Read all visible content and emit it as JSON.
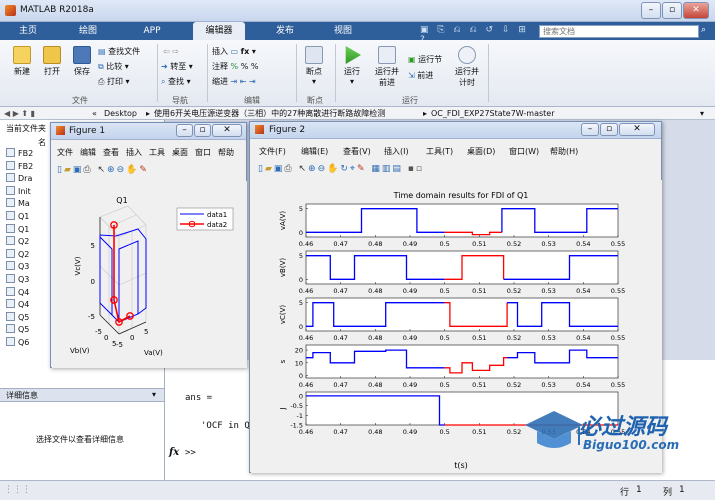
{
  "window": {
    "title": "MATLAB R2018a"
  },
  "search": {
    "placeholder": "搜索文档"
  },
  "main_tabs": [
    "主页",
    "绘图",
    "APP",
    "编辑器",
    "发布",
    "视图"
  ],
  "ribbon": {
    "new": "新建",
    "open": "打开",
    "save": "保存",
    "find_files": "查找文件",
    "compare": "比较",
    "print": "打印",
    "goto": "转至",
    "find": "查找",
    "insert": "插入",
    "comment": "注释",
    "indent": "缩进",
    "breakpoints": "断点",
    "run": "运行",
    "run_advance": "运行并\n前进",
    "run_section": "运行节",
    "advance": "前进",
    "run_time": "运行并\n计时",
    "groups": {
      "file": "文件",
      "nav": "导航",
      "edit": "编辑",
      "bp": "断点",
      "run": "运行"
    }
  },
  "address": {
    "prefix": "«",
    "parts": [
      "Desktop",
      "使用6开关电压源逆变器（三相）中的27种离散进行断路故障检测",
      "OC_FDI_EXP27State7W-master"
    ]
  },
  "left_panel": {
    "header": "当前文件夹",
    "col": "名",
    "files": [
      "FB2",
      "FB2",
      "Dra",
      "Init",
      "Ma",
      "Q1",
      "Q1",
      "Q2",
      "Q2",
      "Q3",
      "Q3",
      "Q4",
      "Q4",
      "Q5",
      "Q5",
      "Q6"
    ],
    "details_title": "详细信息",
    "details_msg": "选择文件以查看详细信息"
  },
  "command": {
    "lines": [
      "ans =",
      "'OCF in Q",
      ">>"
    ],
    "fx": "fx"
  },
  "status": {
    "row_label": "行",
    "row": "1",
    "col_label": "列",
    "col": "1"
  },
  "figure1": {
    "title": "Figure 1",
    "menu": [
      "文件",
      "编辑",
      "查看",
      "插入",
      "工具",
      "桌面",
      "窗口",
      "帮助"
    ],
    "plot_title": "Q1",
    "zlabel": "Vc(V)",
    "xlabel": "Vb(V)",
    "ylabel": "Va(V)",
    "zticks": [
      "5",
      "0",
      "-5"
    ],
    "xticks": [
      "-5",
      "0",
      "5"
    ],
    "yticks": [
      "-5",
      "0",
      "5"
    ],
    "legend": [
      "data1",
      "data2"
    ],
    "series_colors": [
      "#0000ff",
      "#ff0000"
    ]
  },
  "figure2": {
    "title": "Figure 2",
    "menu": [
      "文件(F)",
      "编辑(E)",
      "查看(V)",
      "插入(I)",
      "工具(T)",
      "桌面(D)",
      "窗口(W)",
      "帮助(H)"
    ],
    "plot_title": "Time domain results for FDI of Q1",
    "xlabel": "t(s)",
    "xticks": [
      "0.46",
      "0.47",
      "0.48",
      "0.49",
      "0.5",
      "0.51",
      "0.52",
      "0.53",
      "0.54",
      "0.55"
    ],
    "ylabels": [
      "vA(V)",
      "vB(V)",
      "vC(V)",
      "s",
      "J"
    ],
    "normal_color": "#0000ff",
    "fault_color": "#ff0000"
  },
  "chart_data": [
    {
      "type": "line",
      "title": "Time domain results for FDI of Q1",
      "xlabel": "t(s)",
      "xlim": [
        0.46,
        0.55
      ],
      "panels": [
        {
          "ylabel": "vA(V)",
          "ylim": [
            -1,
            6
          ],
          "yticks": [
            "5",
            "0"
          ],
          "series": [
            {
              "color": "#0000ff",
              "x": [
                0.46,
                0.476,
                0.476,
                0.492,
                0.492,
                0.5
              ],
              "y": [
                0,
                0,
                5,
                5,
                0,
                0
              ]
            },
            {
              "color": "#ff0000",
              "x": [
                0.5,
                0.508,
                0.508,
                0.513,
                0.513,
                0.5165
              ],
              "y": [
                0,
                0,
                -0.5,
                -0.5,
                0,
                0
              ]
            },
            {
              "color": "#0000ff",
              "x": [
                0.5165,
                0.5165,
                0.526,
                0.526,
                0.541,
                0.541,
                0.55
              ],
              "y": [
                0,
                5,
                5,
                0,
                0,
                5,
                5
              ]
            }
          ]
        },
        {
          "ylabel": "vB(V)",
          "ylim": [
            -1,
            6
          ],
          "yticks": [
            "5",
            "0"
          ],
          "series": [
            {
              "color": "#0000ff",
              "x": [
                0.46,
                0.467,
                0.467,
                0.474,
                0.474,
                0.489,
                0.489,
                0.5
              ],
              "y": [
                5,
                5,
                0,
                0,
                5,
                5,
                0,
                0
              ]
            },
            {
              "color": "#ff0000",
              "x": [
                0.5,
                0.505,
                0.505,
                0.517,
                0.517
              ],
              "y": [
                0,
                0,
                5,
                5,
                0
              ]
            },
            {
              "color": "#0000ff",
              "x": [
                0.517,
                0.536,
                0.536,
                0.55
              ],
              "y": [
                0,
                0,
                5,
                5
              ]
            }
          ]
        },
        {
          "ylabel": "vC(V)",
          "ylim": [
            -1,
            6
          ],
          "yticks": [
            "5",
            "0"
          ],
          "series": [
            {
              "color": "#0000ff",
              "x": [
                0.46,
                0.462,
                0.462,
                0.468,
                0.468,
                0.483,
                0.483,
                0.5
              ],
              "y": [
                0,
                0,
                5,
                5,
                0,
                0,
                5,
                5
              ]
            },
            {
              "color": "#ff0000",
              "x": [
                0.5,
                0.5015,
                0.5015,
                0.518,
                0.518
              ],
              "y": [
                5,
                5,
                0,
                0,
                5
              ]
            },
            {
              "color": "#0000ff",
              "x": [
                0.518,
                0.521,
                0.521,
                0.528,
                0.528,
                0.536,
                0.536,
                0.55
              ],
              "y": [
                5,
                5,
                0,
                0,
                5,
                5,
                0,
                0
              ]
            }
          ]
        },
        {
          "ylabel": "s",
          "ylim": [
            -2,
            24
          ],
          "yticks": [
            "20",
            "10",
            "0"
          ],
          "series": [
            {
              "color": "#0000ff",
              "x": [
                0.46,
                0.462,
                0.462,
                0.467,
                0.467,
                0.474,
                0.474,
                0.483,
                0.483,
                0.489,
                0.489,
                0.5
              ],
              "y": [
                14,
                14,
                18,
                18,
                10,
                10,
                19,
                19,
                20,
                20,
                6,
                6
              ]
            },
            {
              "color": "#ff0000",
              "x": [
                0.5,
                0.5015,
                0.5015,
                0.505,
                0.505,
                0.508,
                0.508,
                0.513,
                0.513,
                0.517,
                0.517,
                0.518
              ],
              "y": [
                6,
                6,
                2,
                2,
                10,
                10,
                4,
                4,
                8,
                8,
                14,
                14
              ]
            },
            {
              "color": "#0000ff",
              "x": [
                0.518,
                0.521,
                0.521,
                0.526,
                0.526,
                0.536,
                0.536,
                0.541,
                0.541,
                0.55
              ],
              "y": [
                14,
                14,
                18,
                18,
                10,
                10,
                20,
                20,
                14,
                14
              ]
            }
          ]
        },
        {
          "ylabel": "J",
          "ylim": [
            -1.5,
            0.2
          ],
          "yticks": [
            "0",
            "-0.5",
            "-1",
            "-1.5"
          ],
          "series": [
            {
              "color": "#0000ff",
              "x": [
                0.46,
                0.4985,
                0.4985,
                0.5
              ],
              "y": [
                0,
                0,
                -1.5,
                -1.5
              ]
            },
            {
              "color": "#ff0000",
              "x": [
                0.5,
                0.55
              ],
              "y": [
                -1.5,
                -1.5
              ]
            }
          ]
        }
      ]
    },
    {
      "type": "line",
      "title": "Q1",
      "xlabel": "Vb(V)",
      "ylabel": "Va(V)",
      "zlabel": "Vc(V)",
      "legend": [
        "data1",
        "data2"
      ]
    }
  ]
}
